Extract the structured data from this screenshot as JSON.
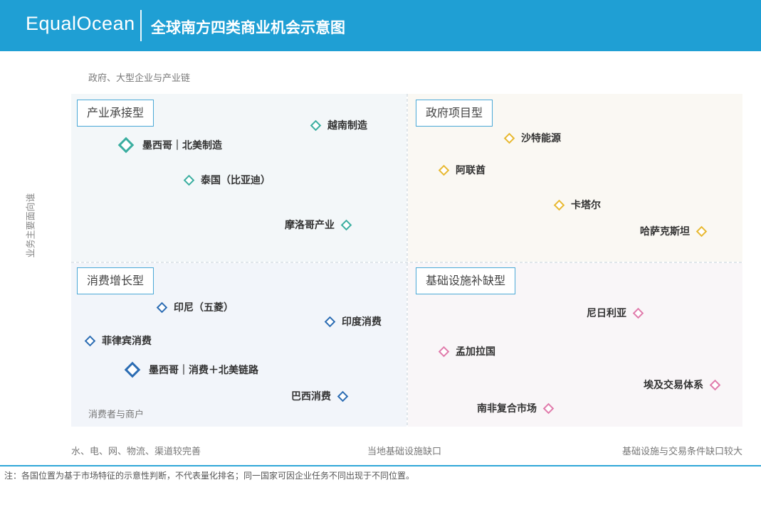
{
  "header": {
    "logo": "EqualOcean",
    "title": "全球南方四类商业机会示意图"
  },
  "axes": {
    "top_label": "政府、大型企业与产业链",
    "bottom_label": "消费者与商户",
    "y_label": "业务主要面向谁",
    "x_left": "水、电、网、物流、渠道较完善",
    "x_center": "当地基础设施缺口",
    "x_right": "基础设施与交易条件缺口较大"
  },
  "quadrants": [
    {
      "label": "产业承接型",
      "color": "#3aaea0"
    },
    {
      "label": "政府项目型",
      "color": "#e8b830"
    },
    {
      "label": "消费增长型",
      "color": "#2b6cb3"
    },
    {
      "label": "基础设施补缺型",
      "color": "#e07aab"
    }
  ],
  "points": {
    "vietnam": "越南制造",
    "mexico_mfg": "墨西哥｜北美制造",
    "thailand": "泰国（比亚迪）",
    "morocco": "摩洛哥产业",
    "saudi": "沙特能源",
    "uae": "阿联酋",
    "qatar": "卡塔尔",
    "kazakhstan": "哈萨克斯坦",
    "indonesia": "印尼（五菱）",
    "india": "印度消费",
    "philippines": "菲律宾消费",
    "mexico_consumer": "墨西哥｜消费＋北美链路",
    "brazil": "巴西消费",
    "nigeria": "尼日利亚",
    "bangladesh": "孟加拉国",
    "egypt": "埃及交易体系",
    "south_africa": "南非复合市场"
  },
  "note": "注：各国位置为基于市场特征的示意性判断，不代表量化排名；同一国家可因企业任务不同出现于不同位置。"
}
